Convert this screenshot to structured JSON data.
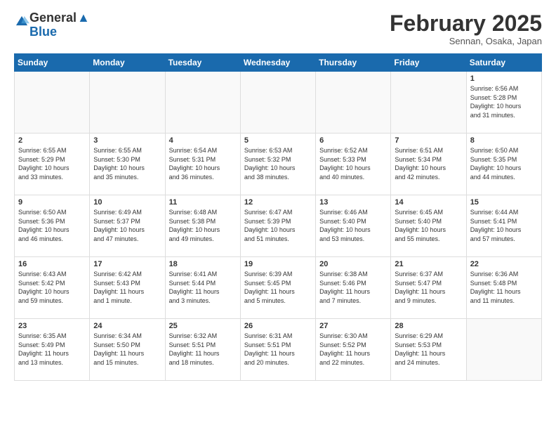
{
  "header": {
    "logo_general": "General",
    "logo_blue": "Blue",
    "month_title": "February 2025",
    "subtitle": "Sennan, Osaka, Japan"
  },
  "days_of_week": [
    "Sunday",
    "Monday",
    "Tuesday",
    "Wednesday",
    "Thursday",
    "Friday",
    "Saturday"
  ],
  "weeks": [
    [
      {
        "day": "",
        "info": ""
      },
      {
        "day": "",
        "info": ""
      },
      {
        "day": "",
        "info": ""
      },
      {
        "day": "",
        "info": ""
      },
      {
        "day": "",
        "info": ""
      },
      {
        "day": "",
        "info": ""
      },
      {
        "day": "1",
        "info": "Sunrise: 6:56 AM\nSunset: 5:28 PM\nDaylight: 10 hours\nand 31 minutes."
      }
    ],
    [
      {
        "day": "2",
        "info": "Sunrise: 6:55 AM\nSunset: 5:29 PM\nDaylight: 10 hours\nand 33 minutes."
      },
      {
        "day": "3",
        "info": "Sunrise: 6:55 AM\nSunset: 5:30 PM\nDaylight: 10 hours\nand 35 minutes."
      },
      {
        "day": "4",
        "info": "Sunrise: 6:54 AM\nSunset: 5:31 PM\nDaylight: 10 hours\nand 36 minutes."
      },
      {
        "day": "5",
        "info": "Sunrise: 6:53 AM\nSunset: 5:32 PM\nDaylight: 10 hours\nand 38 minutes."
      },
      {
        "day": "6",
        "info": "Sunrise: 6:52 AM\nSunset: 5:33 PM\nDaylight: 10 hours\nand 40 minutes."
      },
      {
        "day": "7",
        "info": "Sunrise: 6:51 AM\nSunset: 5:34 PM\nDaylight: 10 hours\nand 42 minutes."
      },
      {
        "day": "8",
        "info": "Sunrise: 6:50 AM\nSunset: 5:35 PM\nDaylight: 10 hours\nand 44 minutes."
      }
    ],
    [
      {
        "day": "9",
        "info": "Sunrise: 6:50 AM\nSunset: 5:36 PM\nDaylight: 10 hours\nand 46 minutes."
      },
      {
        "day": "10",
        "info": "Sunrise: 6:49 AM\nSunset: 5:37 PM\nDaylight: 10 hours\nand 47 minutes."
      },
      {
        "day": "11",
        "info": "Sunrise: 6:48 AM\nSunset: 5:38 PM\nDaylight: 10 hours\nand 49 minutes."
      },
      {
        "day": "12",
        "info": "Sunrise: 6:47 AM\nSunset: 5:39 PM\nDaylight: 10 hours\nand 51 minutes."
      },
      {
        "day": "13",
        "info": "Sunrise: 6:46 AM\nSunset: 5:40 PM\nDaylight: 10 hours\nand 53 minutes."
      },
      {
        "day": "14",
        "info": "Sunrise: 6:45 AM\nSunset: 5:40 PM\nDaylight: 10 hours\nand 55 minutes."
      },
      {
        "day": "15",
        "info": "Sunrise: 6:44 AM\nSunset: 5:41 PM\nDaylight: 10 hours\nand 57 minutes."
      }
    ],
    [
      {
        "day": "16",
        "info": "Sunrise: 6:43 AM\nSunset: 5:42 PM\nDaylight: 10 hours\nand 59 minutes."
      },
      {
        "day": "17",
        "info": "Sunrise: 6:42 AM\nSunset: 5:43 PM\nDaylight: 11 hours\nand 1 minute."
      },
      {
        "day": "18",
        "info": "Sunrise: 6:41 AM\nSunset: 5:44 PM\nDaylight: 11 hours\nand 3 minutes."
      },
      {
        "day": "19",
        "info": "Sunrise: 6:39 AM\nSunset: 5:45 PM\nDaylight: 11 hours\nand 5 minutes."
      },
      {
        "day": "20",
        "info": "Sunrise: 6:38 AM\nSunset: 5:46 PM\nDaylight: 11 hours\nand 7 minutes."
      },
      {
        "day": "21",
        "info": "Sunrise: 6:37 AM\nSunset: 5:47 PM\nDaylight: 11 hours\nand 9 minutes."
      },
      {
        "day": "22",
        "info": "Sunrise: 6:36 AM\nSunset: 5:48 PM\nDaylight: 11 hours\nand 11 minutes."
      }
    ],
    [
      {
        "day": "23",
        "info": "Sunrise: 6:35 AM\nSunset: 5:49 PM\nDaylight: 11 hours\nand 13 minutes."
      },
      {
        "day": "24",
        "info": "Sunrise: 6:34 AM\nSunset: 5:50 PM\nDaylight: 11 hours\nand 15 minutes."
      },
      {
        "day": "25",
        "info": "Sunrise: 6:32 AM\nSunset: 5:51 PM\nDaylight: 11 hours\nand 18 minutes."
      },
      {
        "day": "26",
        "info": "Sunrise: 6:31 AM\nSunset: 5:51 PM\nDaylight: 11 hours\nand 20 minutes."
      },
      {
        "day": "27",
        "info": "Sunrise: 6:30 AM\nSunset: 5:52 PM\nDaylight: 11 hours\nand 22 minutes."
      },
      {
        "day": "28",
        "info": "Sunrise: 6:29 AM\nSunset: 5:53 PM\nDaylight: 11 hours\nand 24 minutes."
      },
      {
        "day": "",
        "info": ""
      }
    ]
  ]
}
